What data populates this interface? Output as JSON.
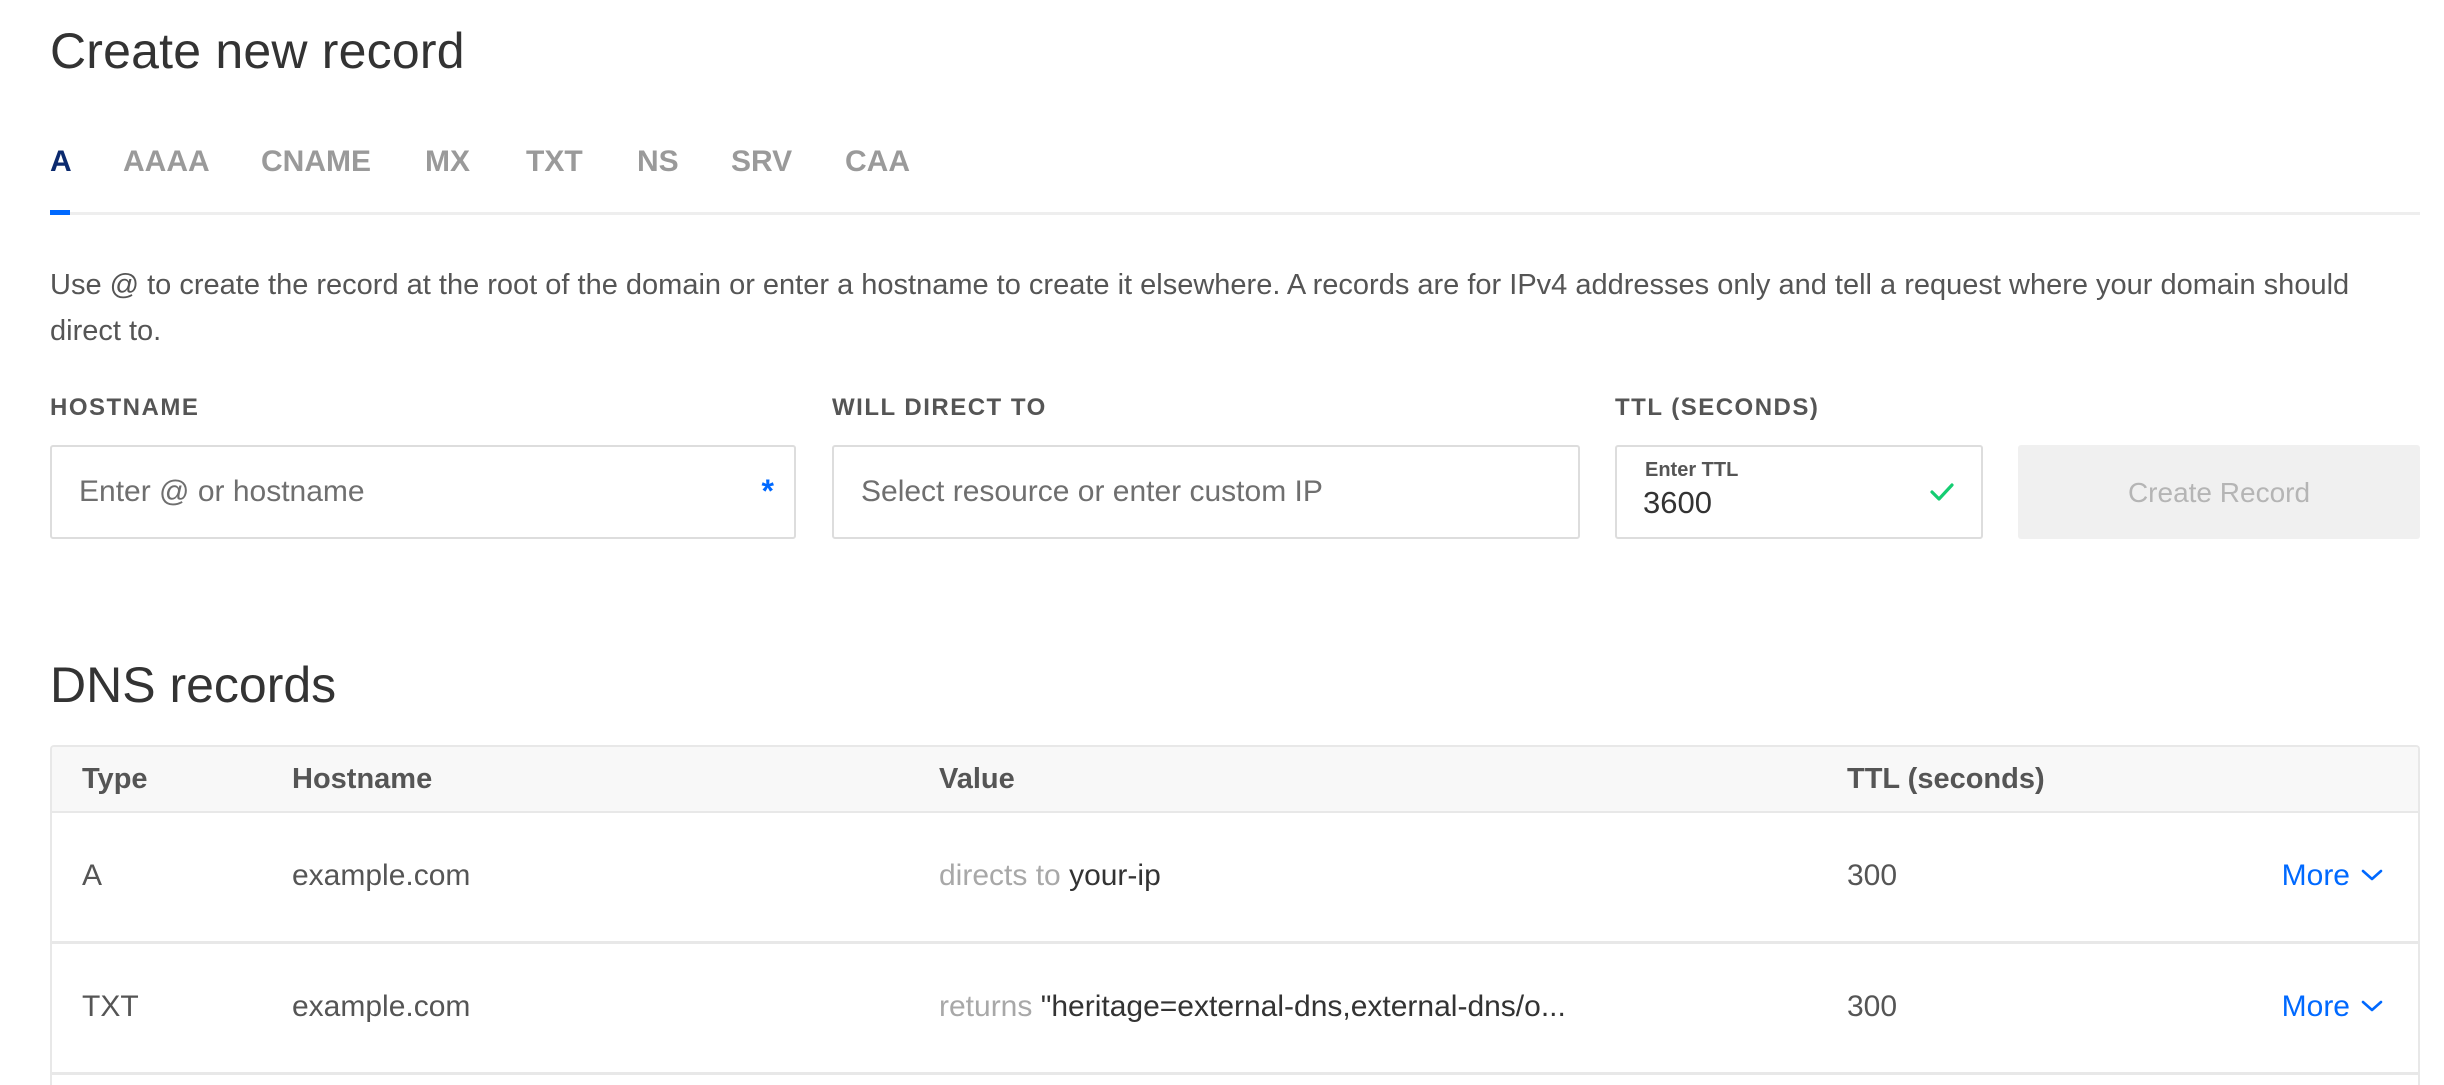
{
  "create": {
    "title": "Create new record",
    "tabs": [
      {
        "label": "A",
        "active": true
      },
      {
        "label": "AAAA",
        "active": false
      },
      {
        "label": "CNAME",
        "active": false
      },
      {
        "label": "MX",
        "active": false
      },
      {
        "label": "TXT",
        "active": false
      },
      {
        "label": "NS",
        "active": false
      },
      {
        "label": "SRV",
        "active": false
      },
      {
        "label": "CAA",
        "active": false
      }
    ],
    "description": "Use @ to create the record at the root of the domain or enter a hostname to create it elsewhere. A records are for IPv4 addresses only and tell a request where your domain should direct to.",
    "hostname": {
      "label": "HOSTNAME",
      "placeholder": "Enter @ or hostname",
      "required_mark": "*"
    },
    "direct_to": {
      "label": "WILL DIRECT TO",
      "placeholder": "Select resource or enter custom IP"
    },
    "ttl": {
      "label": "TTL (SECONDS)",
      "inner_label": "Enter TTL",
      "value": "3600",
      "valid": true
    },
    "create_button": "Create Record"
  },
  "dns": {
    "title": "DNS records",
    "columns": [
      "Type",
      "Hostname",
      "Value",
      "TTL (seconds)"
    ],
    "rows": [
      {
        "type": "A",
        "hostname": "example.com",
        "value_prefix": "directs to",
        "value": "your-ip",
        "ttl": "300",
        "more": "More"
      },
      {
        "type": "TXT",
        "hostname": "example.com",
        "value_prefix": "returns",
        "value": "\"heritage=external-dns,external-dns/o...",
        "ttl": "300",
        "more": "More"
      }
    ]
  },
  "colors": {
    "accent": "#0069ff",
    "active_tab": "#0b2a6f",
    "success": "#15cd72"
  },
  "icons": {
    "ttl_valid": "check-icon",
    "more": "chevron-down-icon"
  }
}
